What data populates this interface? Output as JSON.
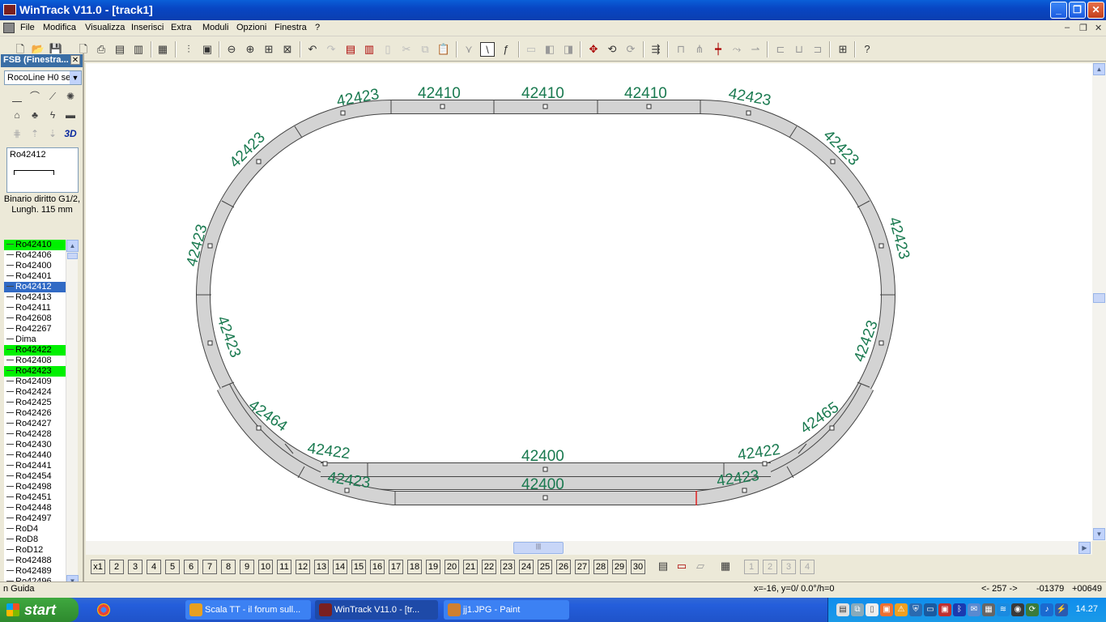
{
  "window": {
    "title": "WinTrack  V11.0 - [track1]"
  },
  "menu": [
    "File",
    "Modifica",
    "Visualizza",
    "Inserisci",
    "Extra",
    "Moduli",
    "Opzioni",
    "Finestra",
    "?"
  ],
  "fsb": {
    "title": "FSB (Finestra...",
    "close": "✕",
    "catalog_select": "RocoLine H0 se",
    "preview_name": "Ro42412",
    "description": "Binario diritto G1/2, Lungh. 115 mm",
    "items": [
      {
        "label": "Ro42410",
        "state": "green"
      },
      {
        "label": "Ro42406",
        "state": ""
      },
      {
        "label": "Ro42400",
        "state": ""
      },
      {
        "label": "Ro42401",
        "state": ""
      },
      {
        "label": "Ro42412",
        "state": "selected"
      },
      {
        "label": "Ro42413",
        "state": ""
      },
      {
        "label": "Ro42411",
        "state": ""
      },
      {
        "label": "Ro42608",
        "state": ""
      },
      {
        "label": "Ro42267",
        "state": ""
      },
      {
        "label": "Dima",
        "state": ""
      },
      {
        "label": "Ro42422",
        "state": "green"
      },
      {
        "label": "Ro42408",
        "state": ""
      },
      {
        "label": "Ro42423",
        "state": "green"
      },
      {
        "label": "Ro42409",
        "state": ""
      },
      {
        "label": "Ro42424",
        "state": ""
      },
      {
        "label": "Ro42425",
        "state": ""
      },
      {
        "label": "Ro42426",
        "state": ""
      },
      {
        "label": "Ro42427",
        "state": ""
      },
      {
        "label": "Ro42428",
        "state": ""
      },
      {
        "label": "Ro42430",
        "state": ""
      },
      {
        "label": "Ro42440",
        "state": ""
      },
      {
        "label": "Ro42441",
        "state": ""
      },
      {
        "label": "Ro42454",
        "state": ""
      },
      {
        "label": "Ro42498",
        "state": ""
      },
      {
        "label": "Ro42451",
        "state": ""
      },
      {
        "label": "Ro42448",
        "state": ""
      },
      {
        "label": "Ro42497",
        "state": ""
      },
      {
        "label": "RoD4",
        "state": ""
      },
      {
        "label": "RoD8",
        "state": ""
      },
      {
        "label": "RoD12",
        "state": ""
      },
      {
        "label": "Ro42488",
        "state": ""
      },
      {
        "label": "Ro42489",
        "state": ""
      },
      {
        "label": "Ro42496",
        "state": ""
      }
    ]
  },
  "track_labels": {
    "top_left_curve": "42423",
    "top_straight": "42410",
    "top_right_curve": "42423",
    "right_upper_1": "42423",
    "right_mid": "42423",
    "right_lower": "42423",
    "left_upper": "42423",
    "left_mid": "42423",
    "left_lower": "42423",
    "switch_left": "42464",
    "switch_right": "42465",
    "inner_left_curve": "42422",
    "inner_right_curve": "42422",
    "bottom_inner_straight": "42400",
    "bottom_outer_straight": "42400",
    "outer_left_curve": "42423",
    "outer_right_curve": "42423"
  },
  "layers": [
    "x1",
    "2",
    "3",
    "4",
    "5",
    "6",
    "7",
    "8",
    "9",
    "10",
    "11",
    "12",
    "13",
    "14",
    "15",
    "16",
    "17",
    "18",
    "19",
    "20",
    "21",
    "22",
    "23",
    "24",
    "25",
    "26",
    "27",
    "28",
    "29",
    "30"
  ],
  "layers_extra": [
    "1",
    "2",
    "3",
    "4"
  ],
  "status": {
    "left": "n Guida",
    "coords": "x=-16, y=0/ 0.0°/h=0",
    "nav": "<- 257 ->",
    "x": "-01379",
    "y": "+00649"
  },
  "taskbar": {
    "start": "start",
    "tasks": [
      {
        "label": "Scala TT - il forum sull...",
        "active": false,
        "color": "#e8a020"
      },
      {
        "label": "WinTrack  V11.0 - [tr...",
        "active": true,
        "color": "#7a2020"
      },
      {
        "label": "jj1.JPG - Paint",
        "active": false,
        "color": "#d08030"
      }
    ],
    "clock": "14.27"
  }
}
